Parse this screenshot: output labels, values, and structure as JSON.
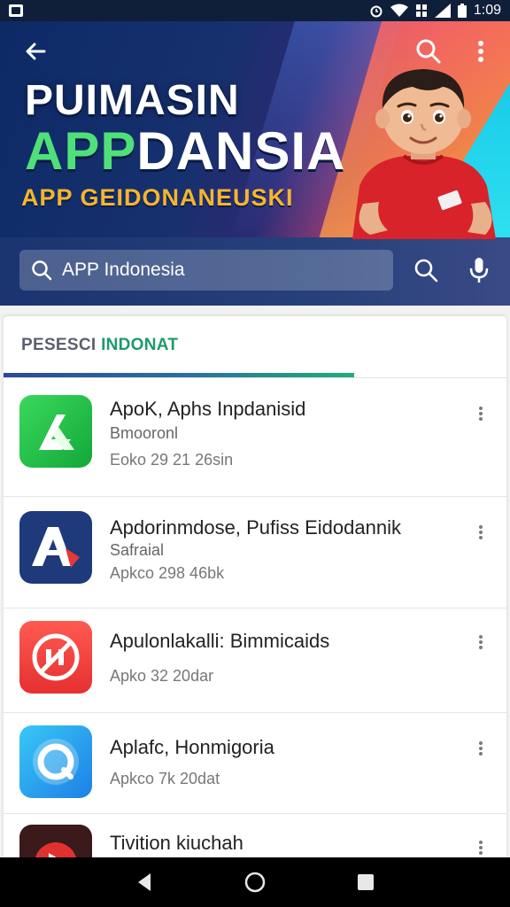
{
  "status_bar": {
    "time": "1:09",
    "icons": [
      "notification-icon",
      "alarm-icon",
      "wifi-icon",
      "data-icon",
      "signal-icon",
      "battery-icon"
    ]
  },
  "header": {
    "banner_line1": "PUIMASIN",
    "banner_line2_green": "APP",
    "banner_line2_white": "DANSIA",
    "banner_subtitle": "APP GEIDONANEUSKI",
    "search_value": "APP Indonesia",
    "icons": [
      "back-arrow-icon",
      "search-icon",
      "more-vert-icon",
      "mic-icon"
    ]
  },
  "section": {
    "tab_part1": "PESESCI",
    "tab_part2": "INDONAT"
  },
  "apps": [
    {
      "title": "ApoK, Aphs Inpdanisid",
      "subtitle": "Bmooronl",
      "meta": "Eoko 29 21 26sin",
      "icon": "green-arrow-app-icon"
    },
    {
      "title": "Apdorinmdose, Pufiss Eidodannik",
      "subtitle": "Safraial",
      "meta": "Apkco 298 46bk",
      "icon": "letter-a-app-icon"
    },
    {
      "title": "Apulonlakalli: Bimmicaids",
      "subtitle": "",
      "meta": "Apko 32 20dar",
      "icon": "no-circle-app-icon"
    },
    {
      "title": "Aplafc, Honmigoria",
      "subtitle": "",
      "meta": "Apkco 7k 20dat",
      "icon": "ring-app-icon"
    },
    {
      "title": "Tivition kiuchah",
      "subtitle": "",
      "meta": "",
      "icon": "red-play-app-icon"
    }
  ],
  "colors": {
    "accent_green": "#1d9a6c",
    "header_blue": "#0c2a66",
    "banner_yellow": "#f5b52e"
  },
  "nav": {
    "icons": [
      "back-triangle-icon",
      "home-circle-icon",
      "recents-square-icon"
    ]
  }
}
